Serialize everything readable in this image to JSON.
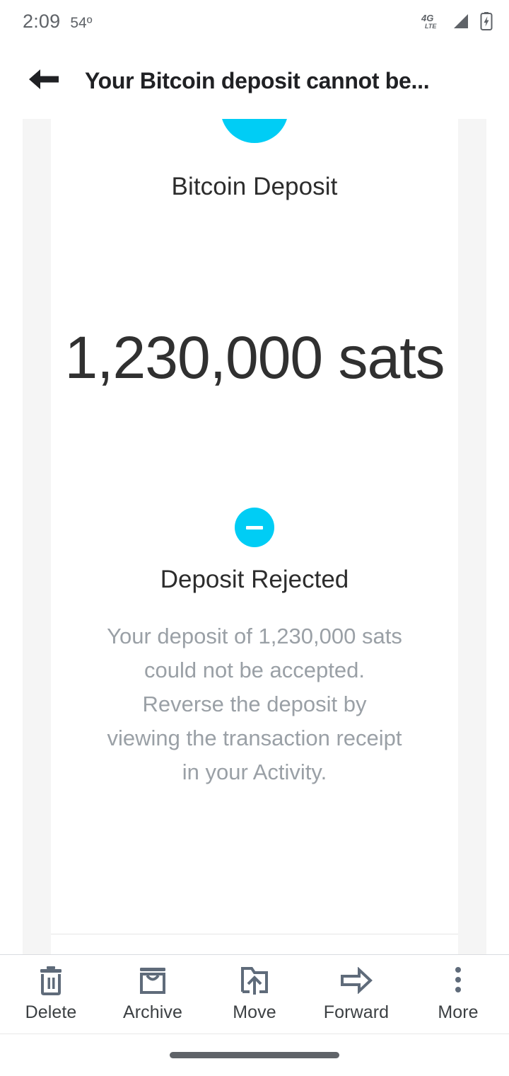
{
  "status_bar": {
    "time": "2:09",
    "temperature": "54º",
    "icons": [
      "4g-lte-icon",
      "signal-icon",
      "battery-charging-icon"
    ]
  },
  "app_bar": {
    "back_icon": "back-arrow-icon",
    "title": "Your Bitcoin deposit cannot be..."
  },
  "email": {
    "logo_icon": "cyan-circle-logo",
    "brand": "Bitcoin Deposit",
    "amount": "1,230,000 sats",
    "status_icon": "minus-circle-icon",
    "status_title": "Deposit Rejected",
    "status_text": "Your deposit of 1,230,000 sats could not be accepted. Reverse the deposit by viewing the transaction receipt in your Activity."
  },
  "toolbar": {
    "items": [
      {
        "label": "Delete",
        "icon": "trash-icon"
      },
      {
        "label": "Archive",
        "icon": "archive-icon"
      },
      {
        "label": "Move",
        "icon": "move-to-folder-icon"
      },
      {
        "label": "Forward",
        "icon": "forward-arrow-icon"
      },
      {
        "label": "More",
        "icon": "more-vertical-icon"
      }
    ]
  },
  "nav_bar": {
    "handle": "gesture-handle"
  },
  "colors": {
    "accent_cyan": "#00cdf5",
    "title_dark": "#202124",
    "body_grey": "#9aa0a6",
    "toolbar_icon": "#5f6b7a"
  }
}
